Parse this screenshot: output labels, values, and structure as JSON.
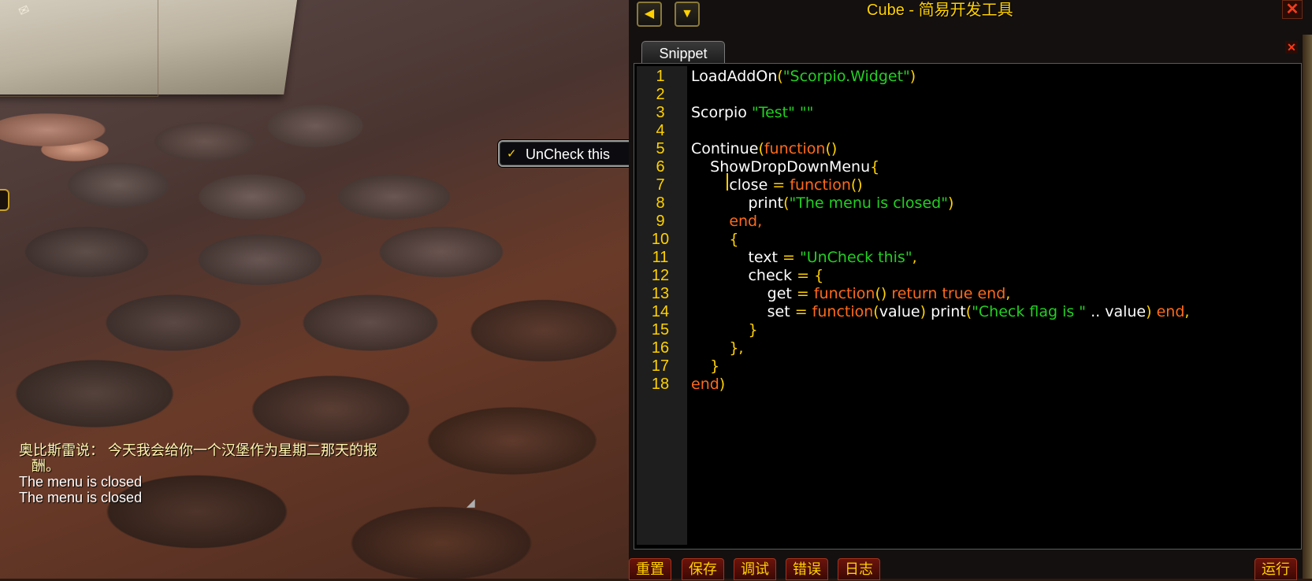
{
  "dropdown": {
    "check_glyph": "✓",
    "item_label": "UnCheck this"
  },
  "chat": [
    {
      "text": "奥比斯雷说： 今天我会给你一个汉堡作为星期二那天的报",
      "cls": "chat-npc"
    },
    {
      "text": "酬。",
      "cls": "chat-npc chat-indent"
    },
    {
      "text": "The menu is closed",
      "cls": "chat-sys"
    },
    {
      "text": "The menu is closed",
      "cls": "chat-sys"
    }
  ],
  "window": {
    "title": "Cube - 简易开发工具",
    "close_glyph": "✕",
    "tab_close_glyph": "✕",
    "nav_left_glyph": "◀",
    "nav_down_glyph": "▼"
  },
  "tabs": [
    {
      "label": "Snippet"
    }
  ],
  "editor": {
    "line_numbers": [
      "1",
      "2",
      "3",
      "4",
      "5",
      "6",
      "7",
      "8",
      "9",
      "10",
      "11",
      "12",
      "13",
      "14",
      "15",
      "16",
      "17",
      "18"
    ],
    "lines": [
      [
        [
          "LoadAddOn",
          ""
        ],
        [
          "(",
          "p"
        ],
        [
          "\"Scorpio.Widget\"",
          "s"
        ],
        [
          ")",
          "p"
        ]
      ],
      [],
      [
        [
          "Scorpio ",
          ""
        ],
        [
          "\"Test\" \"\"",
          "s"
        ]
      ],
      [],
      [
        [
          "Continue",
          ""
        ],
        [
          "(",
          "p"
        ],
        [
          "function",
          "k"
        ],
        [
          "()",
          "p"
        ]
      ],
      [
        [
          "    ShowDropDownMenu",
          ""
        ],
        [
          "{",
          "p"
        ]
      ],
      [
        [
          "        close ",
          ""
        ],
        [
          "=",
          "p"
        ],
        [
          " function",
          "k"
        ],
        [
          "()",
          "p"
        ]
      ],
      [
        [
          "            print",
          ""
        ],
        [
          "(",
          "p"
        ],
        [
          "\"The menu is closed\"",
          "s"
        ],
        [
          ")",
          "p"
        ]
      ],
      [
        [
          "        ",
          ""
        ],
        [
          "end,",
          "k"
        ]
      ],
      [
        [
          "        ",
          ""
        ],
        [
          "{",
          "p"
        ]
      ],
      [
        [
          "            text ",
          ""
        ],
        [
          "=",
          "p"
        ],
        [
          " \"UnCheck this\"",
          "s"
        ],
        [
          ",",
          "p"
        ]
      ],
      [
        [
          "            check ",
          ""
        ],
        [
          "=",
          "p"
        ],
        [
          " {",
          "p"
        ]
      ],
      [
        [
          "                get ",
          ""
        ],
        [
          "=",
          "p"
        ],
        [
          " function",
          "k"
        ],
        [
          "()",
          "p"
        ],
        [
          " return true end",
          "k"
        ],
        [
          ",",
          "p"
        ]
      ],
      [
        [
          "                set ",
          ""
        ],
        [
          "=",
          "p"
        ],
        [
          " function",
          "k"
        ],
        [
          "(",
          "p"
        ],
        [
          "value",
          ""
        ],
        [
          ")",
          "p"
        ],
        [
          " print",
          ""
        ],
        [
          "(",
          "p"
        ],
        [
          "\"Check flag is \"",
          "s"
        ],
        [
          " .. value",
          ""
        ],
        [
          ")",
          "p"
        ],
        [
          " end",
          "k"
        ],
        [
          ",",
          "p"
        ]
      ],
      [
        [
          "            ",
          ""
        ],
        [
          "}",
          "p"
        ]
      ],
      [
        [
          "        ",
          ""
        ],
        [
          "},",
          "p"
        ]
      ],
      [
        [
          "    ",
          ""
        ],
        [
          "}",
          "p"
        ]
      ],
      [
        [
          "end",
          "k"
        ],
        [
          ")",
          "p"
        ]
      ]
    ]
  },
  "buttons": {
    "reset": "重置",
    "save": "保存",
    "debug": "调试",
    "error": "错误",
    "log": "日志",
    "run": "运行"
  },
  "colors": {
    "keyword": "#ff6a1a",
    "string": "#22d022",
    "punct": "#ffd100",
    "text": "#ffffff",
    "line_number": "#ffd100"
  }
}
